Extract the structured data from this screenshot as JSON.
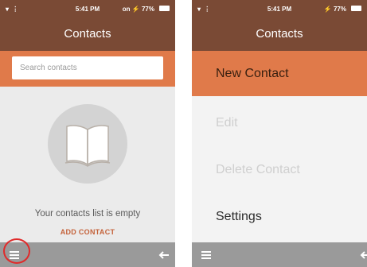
{
  "left_screen": {
    "status_bar": {
      "signal": "▾ ⋮",
      "time": "5:41 PM",
      "right": "on ⚡ 77%"
    },
    "title": "Contacts",
    "search": {
      "placeholder": "Search contacts"
    },
    "empty_message": "Your contacts list is empty",
    "add_contact_label": "ADD CONTACT"
  },
  "right_screen": {
    "status_bar": {
      "signal": "▾ ⋮",
      "time": "5:41 PM",
      "right": "⚡ 77%"
    },
    "title": "Contacts",
    "menu_items": [
      {
        "label": "New Contact",
        "state": "active"
      },
      {
        "label": "Edit",
        "state": "disabled"
      },
      {
        "label": "Delete Contact",
        "state": "disabled"
      },
      {
        "label": "Settings",
        "state": "enabled"
      }
    ]
  },
  "icons": {
    "menu": "hamburger-menu-icon",
    "back": "back-arrow-icon",
    "book": "open-book-icon",
    "battery": "battery-icon"
  },
  "colors": {
    "header": "#7a4a35",
    "accent": "#e07a4a",
    "bottom_bar": "#9a9a9a",
    "highlight": "#e02a2a",
    "link": "#c4623a"
  }
}
